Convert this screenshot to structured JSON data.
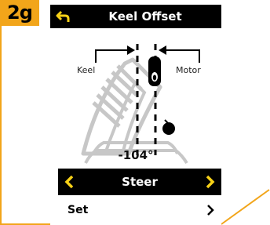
{
  "step_badge": "2g",
  "header": {
    "title": "Keel Offset"
  },
  "illustration": {
    "keel_label": "Keel",
    "motor_label": "Motor",
    "angle_readout": "-104°"
  },
  "menu": {
    "selected_item": "Steer",
    "items": [
      {
        "label": "Set"
      }
    ]
  },
  "colors": {
    "accent_orange": "#F2A51A",
    "arrow_yellow": "#F7D117",
    "bar_black": "#000000",
    "boat_gray": "#C7C7C7"
  }
}
